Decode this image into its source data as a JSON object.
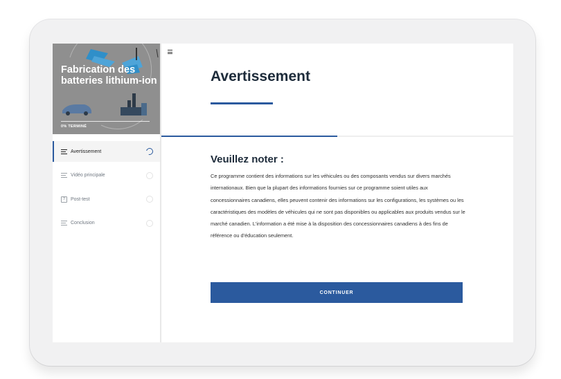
{
  "course": {
    "title": "Fabrication des batteries lithium-ion",
    "progress_label": "0% TERMINÉ",
    "progress_fraction": 0
  },
  "sidebar": {
    "items": [
      {
        "label": "Avertissement",
        "icon": "lines-icon",
        "active": true,
        "status": "in-progress"
      },
      {
        "label": "Vidéo principale",
        "icon": "lines-icon",
        "active": false,
        "status": "not-started"
      },
      {
        "label": "Post-test",
        "icon": "question-box-icon",
        "icon_glyph": "?",
        "active": false,
        "status": "not-started"
      },
      {
        "label": "Conclusion",
        "icon": "lines-icon",
        "active": false,
        "status": "not-started"
      }
    ]
  },
  "main": {
    "menu_icon": "hamburger-icon",
    "page_title": "Avertissement",
    "lesson_progress_fraction": 0.5,
    "section_heading": "Veuillez noter :",
    "body_text": "Ce programme contient des informations sur les véhicules ou des composants vendus sur divers marchés internationaux. Bien que la plupart des informations fournies sur ce programme soient utiles aux concessionnaires canadiens, elles peuvent contenir des informations sur les configurations, les systèmes ou les caractéristiques des modèles de véhicules qui ne sont pas disponibles ou applicables aux produits vendus sur le marché canadien. L'information a été mise à la disposition des concessionnaires canadiens à des fins de référence ou d'éducation seulement.",
    "continue_label": "CONTINUER"
  },
  "colors": {
    "accent": "#2b5a9e",
    "hero_bg": "#8f8f8f",
    "text_dark": "#1d2b3a"
  }
}
